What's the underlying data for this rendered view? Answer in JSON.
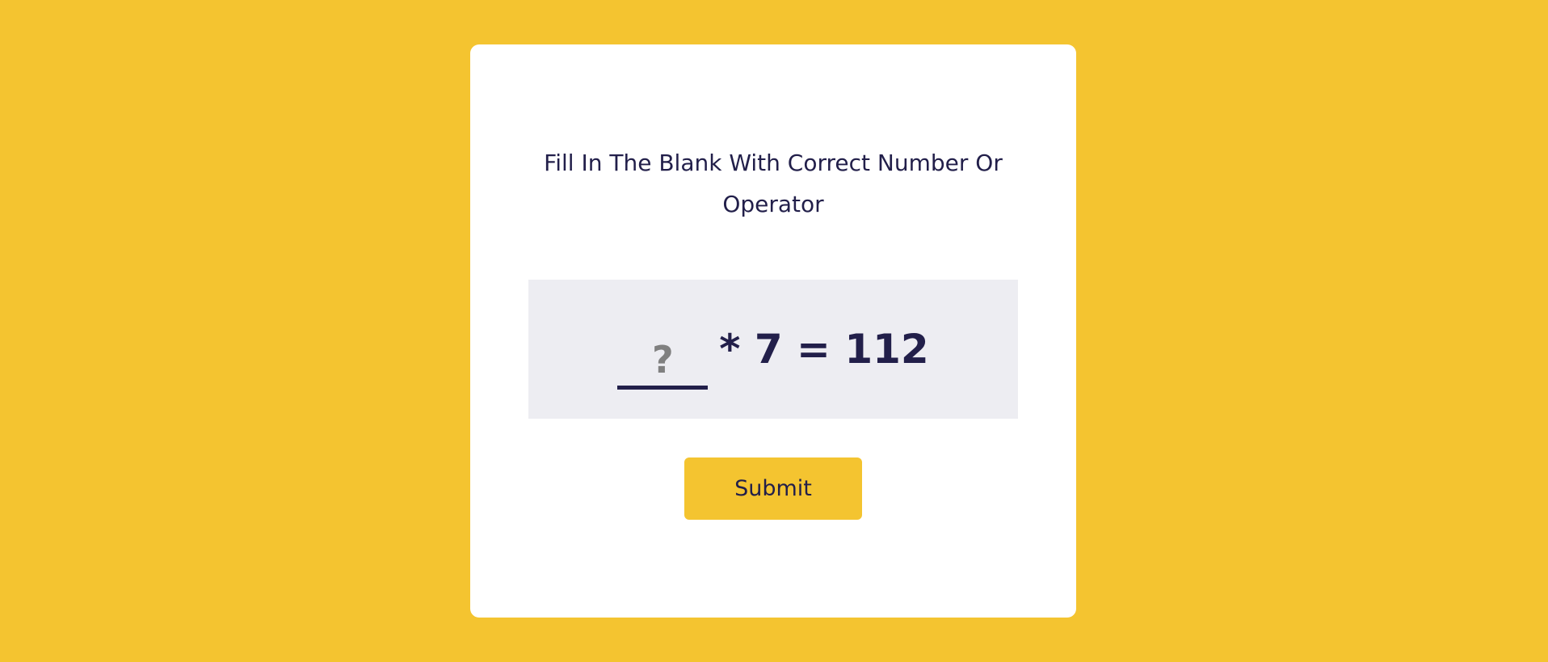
{
  "colors": {
    "background": "#f4c430",
    "card": "#ffffff",
    "text": "#221f4a",
    "equation_box": "#ededf2",
    "placeholder": "#808080"
  },
  "quiz": {
    "instruction": "Fill In The Blank With Correct Number Or Operator",
    "answer_value": "",
    "answer_placeholder": "?",
    "expression": "* 7 = 112",
    "submit_label": "Submit"
  }
}
